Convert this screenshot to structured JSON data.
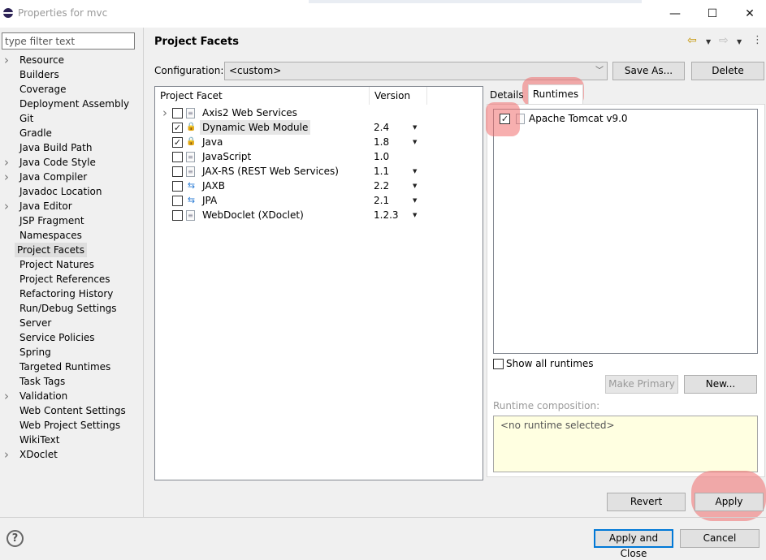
{
  "window": {
    "title": "Properties for mvc",
    "controls": {
      "minimize": "—",
      "maximize": "☐",
      "close": "✕"
    }
  },
  "sidebar": {
    "filter_placeholder": "type filter text",
    "items": [
      {
        "label": "Resource",
        "expandable": true
      },
      {
        "label": "Builders",
        "expandable": false
      },
      {
        "label": "Coverage",
        "expandable": false
      },
      {
        "label": "Deployment Assembly",
        "expandable": false
      },
      {
        "label": "Git",
        "expandable": false
      },
      {
        "label": "Gradle",
        "expandable": false
      },
      {
        "label": "Java Build Path",
        "expandable": false
      },
      {
        "label": "Java Code Style",
        "expandable": true
      },
      {
        "label": "Java Compiler",
        "expandable": true
      },
      {
        "label": "Javadoc Location",
        "expandable": false
      },
      {
        "label": "Java Editor",
        "expandable": true
      },
      {
        "label": "JSP Fragment",
        "expandable": false
      },
      {
        "label": "Namespaces",
        "expandable": false
      },
      {
        "label": "Project Facets",
        "expandable": false,
        "selected": true
      },
      {
        "label": "Project Natures",
        "expandable": false
      },
      {
        "label": "Project References",
        "expandable": false
      },
      {
        "label": "Refactoring History",
        "expandable": false
      },
      {
        "label": "Run/Debug Settings",
        "expandable": false
      },
      {
        "label": "Server",
        "expandable": false
      },
      {
        "label": "Service Policies",
        "expandable": false
      },
      {
        "label": "Spring",
        "expandable": false
      },
      {
        "label": "Targeted Runtimes",
        "expandable": false
      },
      {
        "label": "Task Tags",
        "expandable": false
      },
      {
        "label": "Validation",
        "expandable": true
      },
      {
        "label": "Web Content Settings",
        "expandable": false
      },
      {
        "label": "Web Project Settings",
        "expandable": false
      },
      {
        "label": "WikiText",
        "expandable": false
      },
      {
        "label": "XDoclet",
        "expandable": true
      }
    ]
  },
  "page": {
    "title": "Project Facets",
    "configuration_label": "Configuration:",
    "configuration_value": "<custom>",
    "save_as": "Save As...",
    "delete": "Delete"
  },
  "facets": {
    "header_facet": "Project Facet",
    "header_version": "Version",
    "rows": [
      {
        "name": "Axis2 Web Services",
        "version": "",
        "checked": false,
        "expandable": true,
        "icon": "page",
        "dropdown": false
      },
      {
        "name": "Dynamic Web Module",
        "version": "2.4",
        "checked": true,
        "expandable": false,
        "icon": "web-lock",
        "dropdown": true,
        "highlighted": true
      },
      {
        "name": "Java",
        "version": "1.8",
        "checked": true,
        "expandable": false,
        "icon": "java-lock",
        "dropdown": true
      },
      {
        "name": "JavaScript",
        "version": "1.0",
        "checked": false,
        "expandable": false,
        "icon": "page",
        "dropdown": false
      },
      {
        "name": "JAX-RS (REST Web Services)",
        "version": "1.1",
        "checked": false,
        "expandable": false,
        "icon": "page",
        "dropdown": true
      },
      {
        "name": "JAXB",
        "version": "2.2",
        "checked": false,
        "expandable": false,
        "icon": "arrows",
        "dropdown": true
      },
      {
        "name": "JPA",
        "version": "2.1",
        "checked": false,
        "expandable": false,
        "icon": "arrows",
        "dropdown": true
      },
      {
        "name": "WebDoclet (XDoclet)",
        "version": "1.2.3",
        "checked": false,
        "expandable": false,
        "icon": "page",
        "dropdown": true
      }
    ]
  },
  "runtimes": {
    "tab_details": "Details",
    "tab_runtimes": "Runtimes",
    "list": [
      {
        "name": "Apache Tomcat v9.0",
        "checked": true
      }
    ],
    "show_all_label": "Show all runtimes",
    "show_all_checked": false,
    "make_primary": "Make Primary",
    "new": "New...",
    "composition_label": "Runtime composition:",
    "composition_value": "<no runtime selected>"
  },
  "buttons": {
    "revert": "Revert",
    "apply": "Apply",
    "apply_and_close": "Apply and Close",
    "cancel": "Cancel",
    "help": "?"
  },
  "colors": {
    "highlight": "#f07070",
    "selection": "#dedede",
    "focus": "#0078d7"
  }
}
